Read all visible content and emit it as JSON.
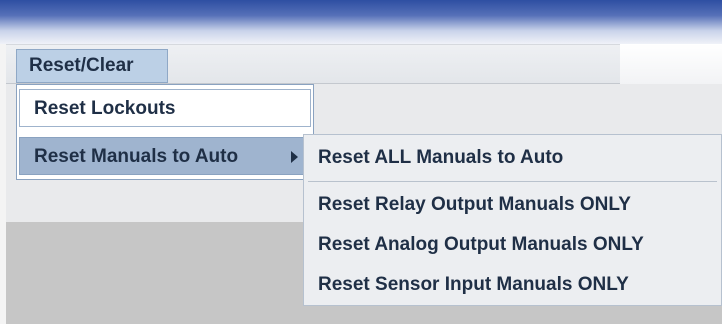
{
  "menubar": {
    "menus": [
      {
        "label": "Reset/Clear"
      }
    ]
  },
  "dropdown": {
    "items": [
      {
        "label": "Reset Lockouts"
      },
      {
        "label": "Reset Manuals to Auto",
        "has_submenu": true
      }
    ]
  },
  "submenu": {
    "items": [
      {
        "label": "Reset ALL Manuals to Auto"
      },
      {
        "label": "Reset Relay Output Manuals ONLY"
      },
      {
        "label": "Reset Analog Output Manuals ONLY"
      },
      {
        "label": "Reset Sensor Input Manuals ONLY"
      }
    ]
  },
  "colors": {
    "title_bar": "#2e4fa2",
    "menu_highlight": "#9fb4cf",
    "text": "#1f2f46"
  }
}
